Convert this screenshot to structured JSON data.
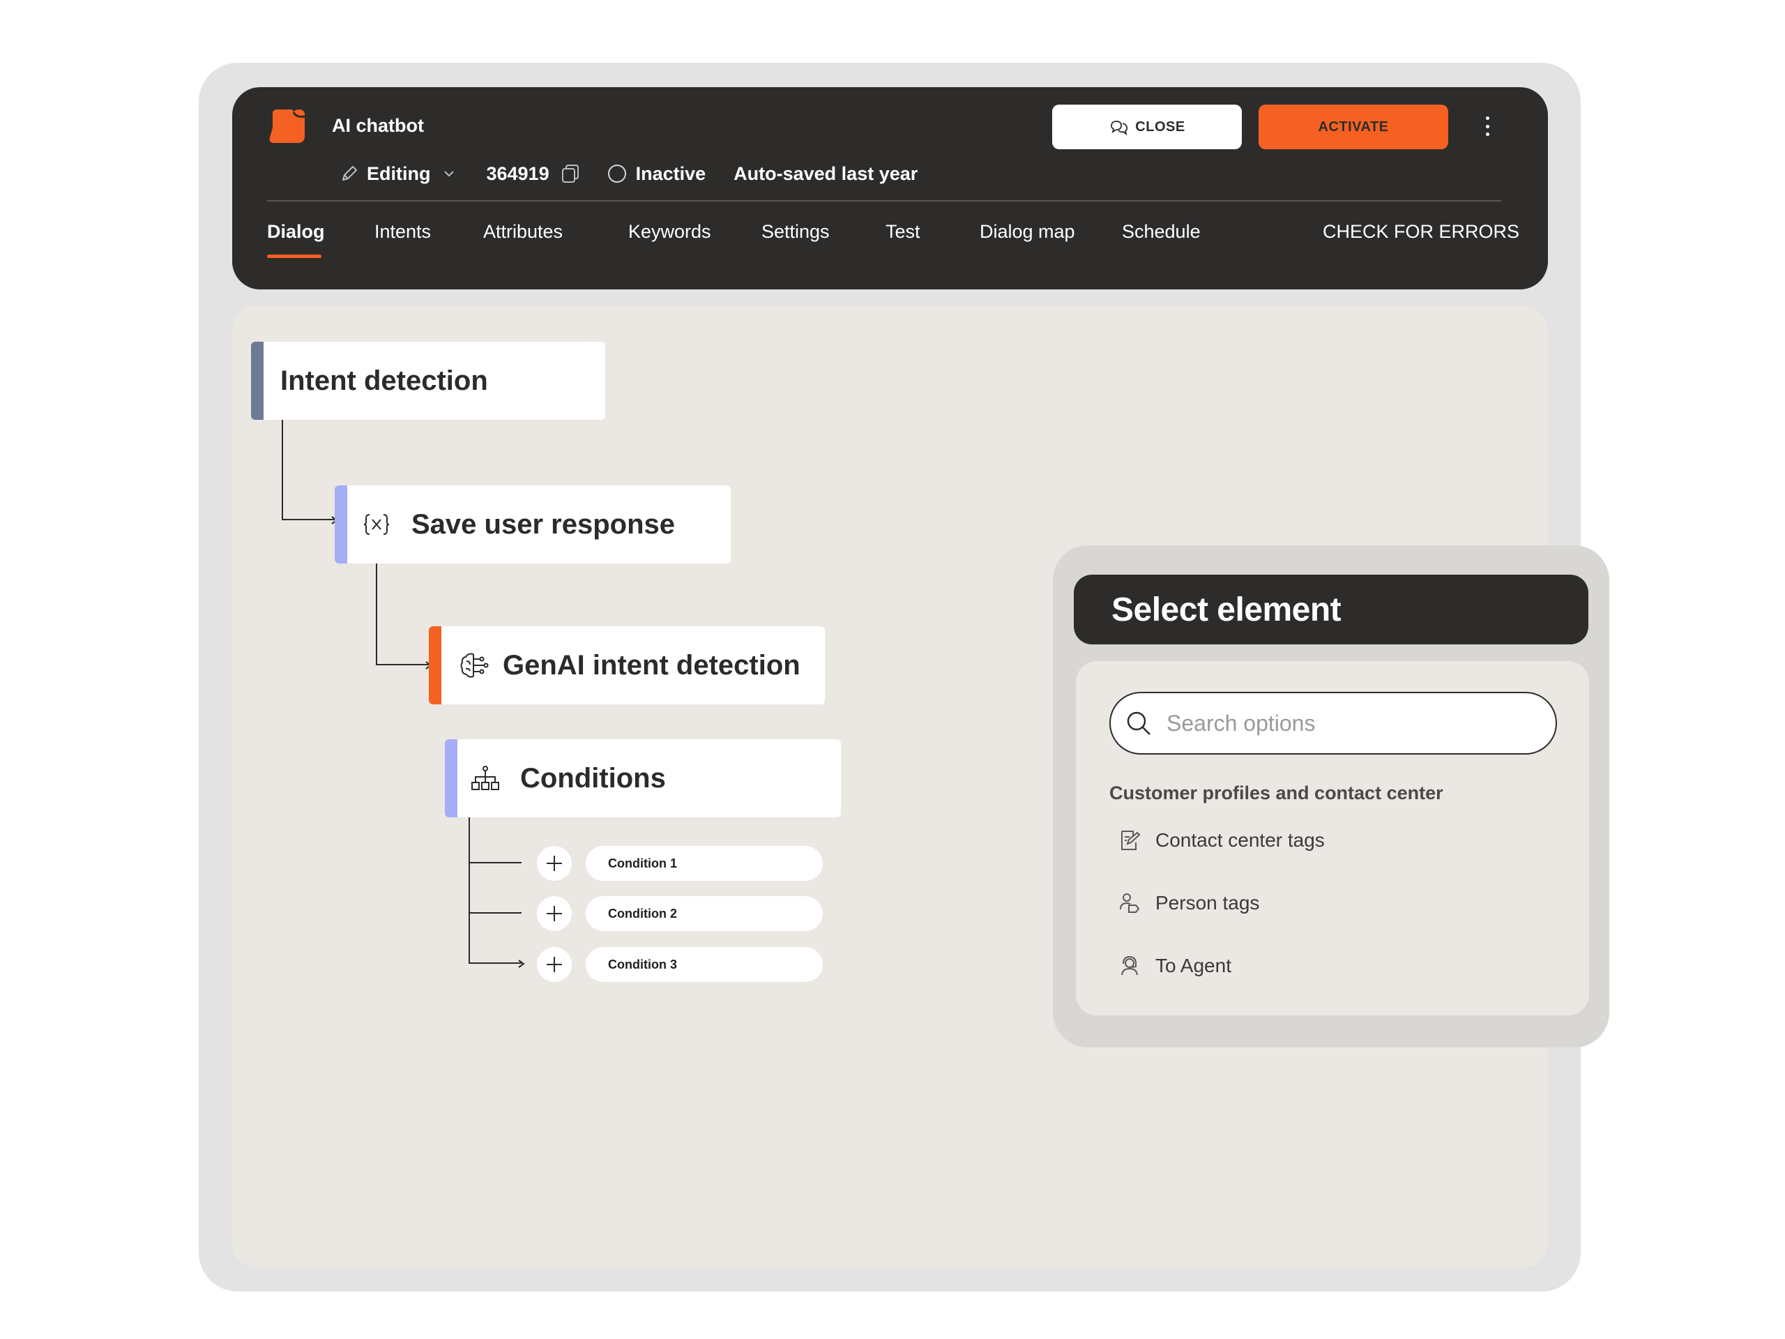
{
  "header": {
    "app_title": "AI chatbot",
    "mode_label": "Editing",
    "bot_id": "364919",
    "status_label": "Inactive",
    "autosave_label": "Auto-saved last year",
    "close_label": "CLOSE",
    "activate_label": "ACTIVATE",
    "brand_color": "#f56122"
  },
  "tabs": [
    {
      "label": "Dialog",
      "active": true
    },
    {
      "label": "Intents"
    },
    {
      "label": "Attributes"
    },
    {
      "label": "Keywords"
    },
    {
      "label": "Settings"
    },
    {
      "label": "Test"
    },
    {
      "label": "Dialog map"
    },
    {
      "label": "Schedule"
    }
  ],
  "check_errors_label": "CHECK FOR ERRORS",
  "flow": {
    "nodes": [
      {
        "title": "Intent detection",
        "accent": "#6d7a96",
        "icon": ""
      },
      {
        "title": "Save user response",
        "accent": "#a4adf6",
        "icon": "variable-icon"
      },
      {
        "title": "GenAI intent detection",
        "accent": "#f56122",
        "icon": "brain-icon"
      },
      {
        "title": "Conditions",
        "accent": "#a4adf6",
        "icon": "hierarchy-icon"
      }
    ],
    "conditions": [
      "Condition 1",
      "Condition 2",
      "Condition 3"
    ]
  },
  "select_panel": {
    "title": "Select element",
    "search_placeholder": "Search options",
    "section_title": "Customer profiles and contact center",
    "options": [
      {
        "label": "Contact center tags",
        "icon": "tag-edit-icon"
      },
      {
        "label": "Person tags",
        "icon": "person-tag-icon"
      },
      {
        "label": "To Agent",
        "icon": "agent-icon"
      }
    ]
  }
}
